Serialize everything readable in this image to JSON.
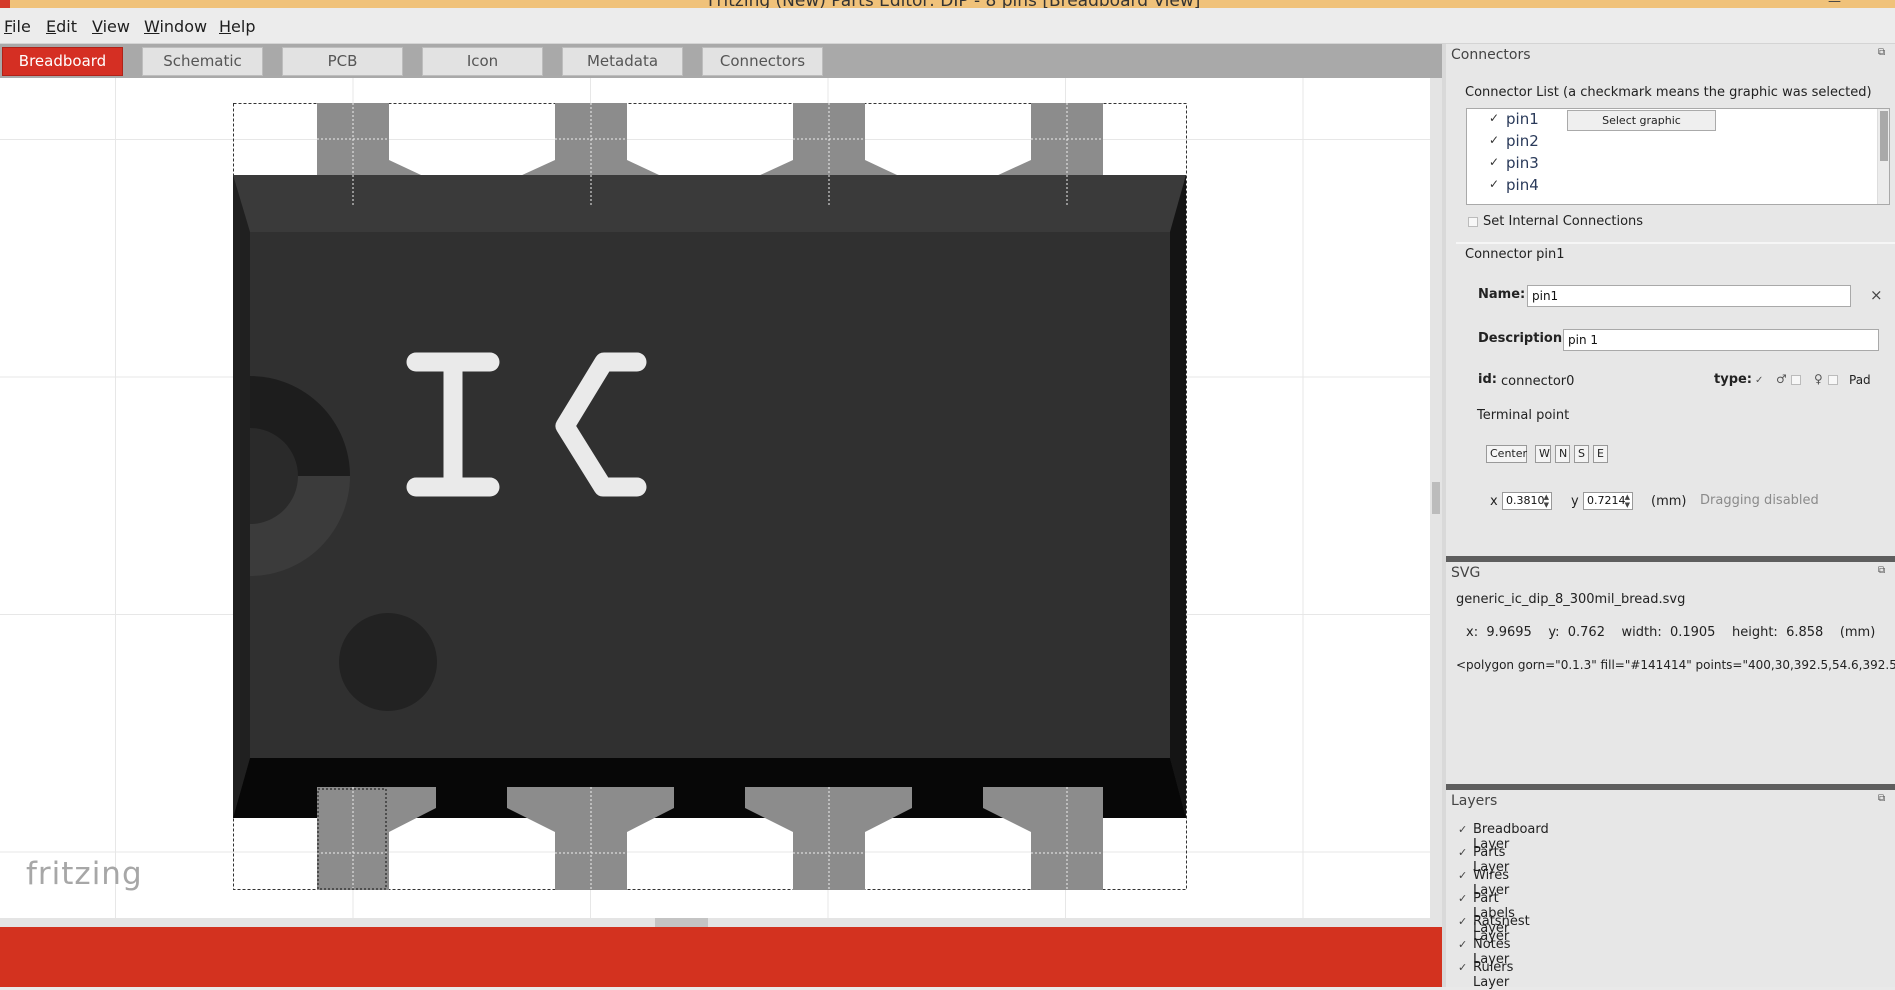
{
  "window": {
    "title": "Fritzing (New) Parts Editor: DIP - 8 pins [Breadboard View]"
  },
  "menubar": [
    {
      "label": "File",
      "accel": "F",
      "rest": "ile"
    },
    {
      "label": "Edit",
      "accel": "E",
      "rest": "dit"
    },
    {
      "label": "View",
      "accel": "V",
      "rest": "iew"
    },
    {
      "label": "Window",
      "accel": "W",
      "rest": "indow"
    },
    {
      "label": "Help",
      "accel": "H",
      "rest": "elp"
    }
  ],
  "tabs": [
    {
      "label": "Breadboard",
      "active": true
    },
    {
      "label": "Schematic",
      "active": false
    },
    {
      "label": "PCB",
      "active": false
    },
    {
      "label": "Icon",
      "active": false
    },
    {
      "label": "Metadata",
      "active": false
    },
    {
      "label": "Connectors",
      "active": false
    }
  ],
  "canvas": {
    "chip_label": "IC",
    "watermark": "fritzing"
  },
  "connectors_panel": {
    "title": "Connectors",
    "list_label": "Connector List (a checkmark means the graphic was selected)",
    "pins": [
      {
        "name": "pin1",
        "checked": true
      },
      {
        "name": "pin2",
        "checked": true
      },
      {
        "name": "pin3",
        "checked": true
      },
      {
        "name": "pin4",
        "checked": true
      }
    ],
    "select_graphic_label": "Select graphic",
    "internal_connections_label": "Set Internal Connections",
    "connector_header": "Connector pin1",
    "name_label": "Name:",
    "name_value": "pin1",
    "clear_icon": "×",
    "description_label": "Description:",
    "description_value": "pin 1",
    "id_label": "id:",
    "id_value": "connector0",
    "type_label": "type:",
    "type_pad_label": "Pad",
    "terminal_point_label": "Terminal point",
    "terminal_buttons": [
      "Center",
      "W",
      "N",
      "S",
      "E"
    ],
    "x_label": "x",
    "x_value": "0.3810",
    "y_label": "y",
    "y_value": "0.7214",
    "unit_label": "(mm)",
    "dragging_label": "Dragging disabled"
  },
  "svg_panel": {
    "title": "SVG",
    "filename": "generic_ic_dip_8_300mil_bread.svg",
    "geometry": "x:  9.9695    y:  0.762    width:  0.1905    height:  6.858    (mm)",
    "element": "<polygon  gorn=\"0.1.3\" fill=\"#141414\" points=\"400,30,392.5,54.6,392.5,275.4,4"
  },
  "layers_panel": {
    "title": "Layers",
    "layers": [
      {
        "name": "Breadboard Layer",
        "checked": true
      },
      {
        "name": "Parts Layer",
        "checked": true
      },
      {
        "name": "Wires Layer",
        "checked": true
      },
      {
        "name": "Part Labels Layer",
        "checked": true
      },
      {
        "name": "Ratsnest Layer",
        "checked": true
      },
      {
        "name": "Notes Layer",
        "checked": true
      },
      {
        "name": "Rulers Layer",
        "checked": true
      }
    ]
  },
  "colors": {
    "accent_red": "#d52f23",
    "chip_body": "#303030",
    "chip_dark": "#141414",
    "pin_gray": "#8c8c8c"
  }
}
